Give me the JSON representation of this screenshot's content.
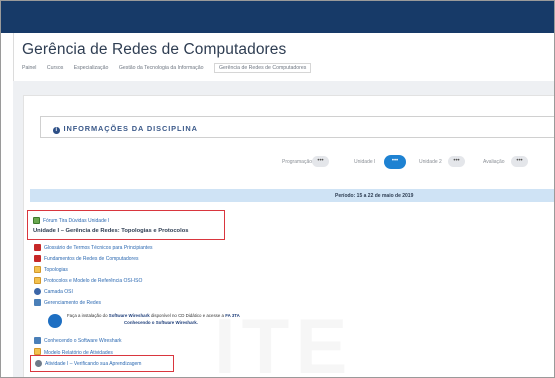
{
  "topbar": {
    "color": "#173a68"
  },
  "header": {
    "title": "Gerência de Redes de Computadores",
    "breadcrumb": [
      "Painel",
      "Cursos",
      "Especialização",
      "Gestão da Tecnologia da Informação",
      "Gerência de Redes de Computadores"
    ]
  },
  "info": {
    "icon": "info-icon",
    "label": "INFORMAÇÕES DA DISCIPLINA"
  },
  "tabs": [
    {
      "label": "Programação",
      "dots": "•••",
      "active": false
    },
    {
      "label": "Unidade I",
      "dots": "•••",
      "active": true
    },
    {
      "label": "Unidade 2",
      "dots": "•••",
      "active": false
    },
    {
      "label": "Avaliação",
      "dots": "•••",
      "active": false
    }
  ],
  "period": "Período: 15 a 22 de maio de 2019",
  "unit": {
    "forum_label": "Fórum Tira Dúvidas Unidade I",
    "title": "Unidade I – Gerência de Redes: Topologias e Protocolos"
  },
  "resources": [
    {
      "label": "Glossário de Termos Técnicos para Principiantes",
      "icon": "pdf-icon"
    },
    {
      "label": "Fundamentos de Redes de Computadores",
      "icon": "pdf-icon"
    },
    {
      "label": "Topologias",
      "icon": "file-icon"
    },
    {
      "label": "Protocolos e Modelo de Referência OSI-ISO",
      "icon": "file-icon"
    },
    {
      "label": "Camada OSI",
      "icon": "circle-icon"
    },
    {
      "label": "Gerenciamento de Redes",
      "icon": "folder-icon"
    }
  ],
  "notice": {
    "line1_prefix": "Faça a instalação do",
    "line1_bold": "Software Wireshark",
    "line1_suffix": "disponível no CD Didático e acesse a",
    "line1_bold2": "FA 3TA",
    "line2": "Conhecendo o Software Wireshark."
  },
  "resources2": [
    {
      "label": "Conhecendo o Software Wireshark",
      "icon": "folder-icon"
    },
    {
      "label": "Modelo Relatório de Atividades",
      "icon": "file-icon"
    }
  ],
  "activity": {
    "label": "Atividade I – Verificando sua Aprendizagem",
    "icon": "activity-icon"
  }
}
